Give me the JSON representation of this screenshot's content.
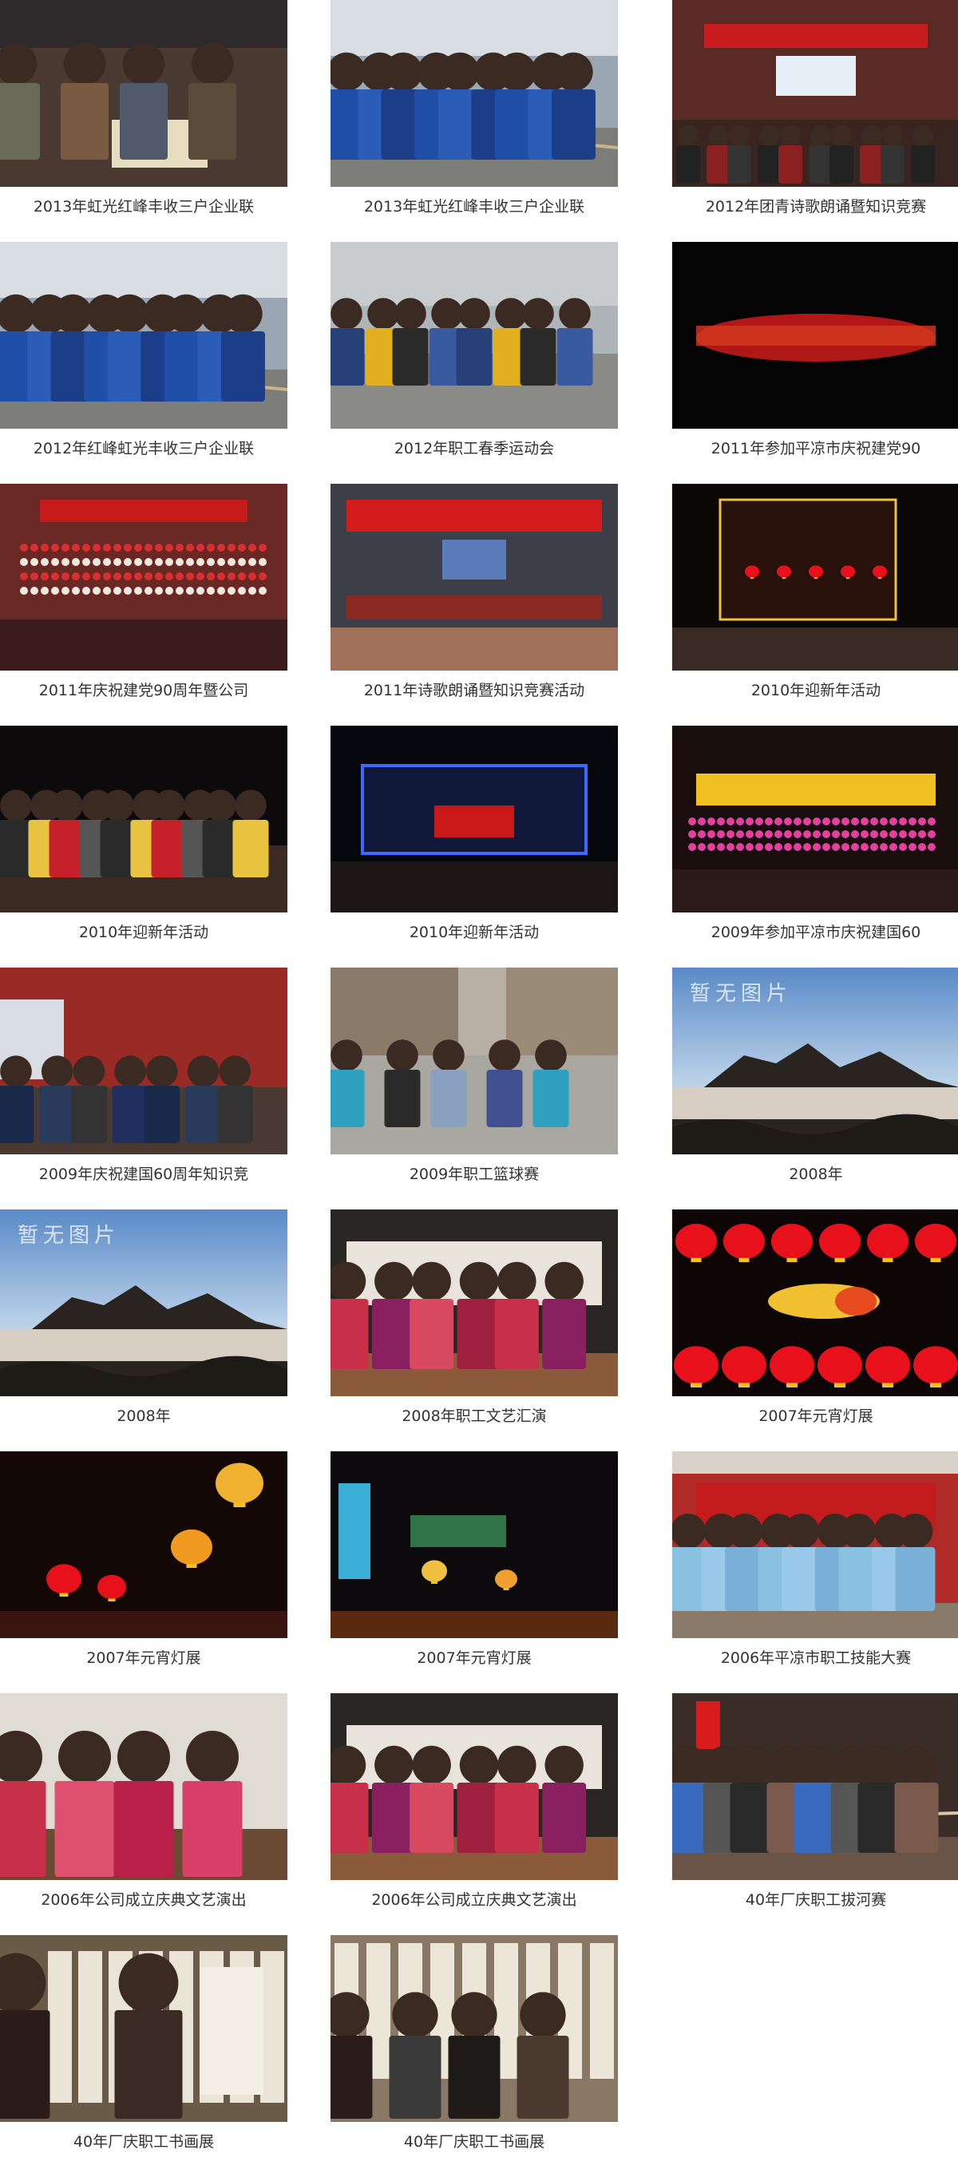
{
  "gallery": {
    "items": [
      {
        "caption": "2013年虹光红峰丰收三户企业联",
        "scene": "chess"
      },
      {
        "caption": "2013年虹光红峰丰收三户企业联",
        "scene": "tugwar_day"
      },
      {
        "caption": "2012年团青诗歌朗诵暨知识竞赛",
        "scene": "hall_red"
      },
      {
        "caption": "2012年红峰虹光丰收三户企业联",
        "scene": "tugwar_day"
      },
      {
        "caption": "2012年职工春季运动会",
        "scene": "sports"
      },
      {
        "caption": "2011年参加平凉市庆祝建党90",
        "scene": "stage_dark"
      },
      {
        "caption": "2011年庆祝建党90周年暨公司",
        "scene": "choir"
      },
      {
        "caption": "2011年诗歌朗诵暨知识竞赛活动",
        "scene": "hall_blue"
      },
      {
        "caption": "2010年迎新年活动",
        "scene": "building_night_gold"
      },
      {
        "caption": "2010年迎新年活动",
        "scene": "night_people"
      },
      {
        "caption": "2010年迎新年活动",
        "scene": "building_night_blue"
      },
      {
        "caption": "2009年参加平凉市庆祝建国60",
        "scene": "choir_pink"
      },
      {
        "caption": "2009年庆祝建国60周年知识竞",
        "scene": "quiz"
      },
      {
        "caption": "2009年职工篮球赛",
        "scene": "basketball"
      },
      {
        "caption": "2008年",
        "scene": "placeholder",
        "watermark": "暂无图片"
      },
      {
        "caption": "2008年",
        "scene": "placeholder",
        "watermark": "暂无图片"
      },
      {
        "caption": "2008年职工文艺汇演",
        "scene": "dance_stage"
      },
      {
        "caption": "2007年元宵灯展",
        "scene": "lanterns_red"
      },
      {
        "caption": "2007年元宵灯展",
        "scene": "lanterns_night"
      },
      {
        "caption": "2007年元宵灯展",
        "scene": "lanterns_night2"
      },
      {
        "caption": "2006年平凉市职工技能大赛",
        "scene": "banner_team"
      },
      {
        "caption": "2006年公司成立庆典文艺演出",
        "scene": "dancers_close"
      },
      {
        "caption": "2006年公司成立庆典文艺演出",
        "scene": "dance_stage"
      },
      {
        "caption": "40年厂庆职工拔河赛",
        "scene": "tugwar_indoor"
      },
      {
        "caption": "40年厂庆职工书画展",
        "scene": "calligraphy"
      },
      {
        "caption": "40年厂庆职工书画展",
        "scene": "calligraphy2"
      }
    ]
  }
}
